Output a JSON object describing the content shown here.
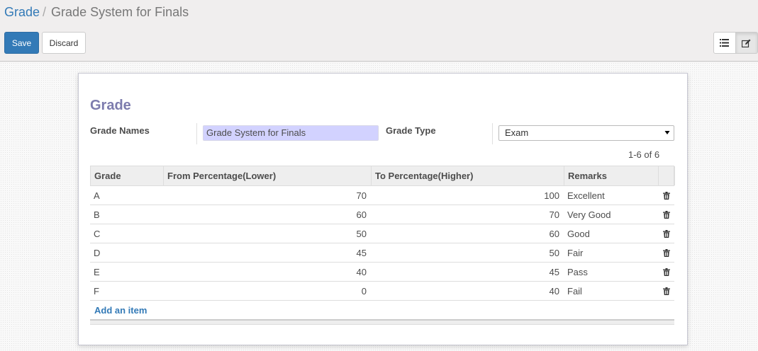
{
  "breadcrumb": {
    "parent": "Grade",
    "separator": "/",
    "current": "Grade System for Finals"
  },
  "toolbar": {
    "save_label": "Save",
    "discard_label": "Discard"
  },
  "view_switcher": {
    "list_icon": "list-icon",
    "form_icon": "edit-icon",
    "active": "form"
  },
  "form": {
    "title": "Grade",
    "grade_names_label": "Grade Names",
    "grade_names_value": "Grade System for Finals",
    "grade_type_label": "Grade Type",
    "grade_type_value": "Exam"
  },
  "pager": "1-6 of 6",
  "grid": {
    "headers": [
      "Grade",
      "From Percentage(Lower)",
      "To Percentage(Higher)",
      "Remarks"
    ],
    "rows": [
      {
        "grade": "A",
        "from": "70",
        "to": "100",
        "remarks": "Excellent"
      },
      {
        "grade": "B",
        "from": "60",
        "to": "70",
        "remarks": "Very Good"
      },
      {
        "grade": "C",
        "from": "50",
        "to": "60",
        "remarks": "Good"
      },
      {
        "grade": "D",
        "from": "45",
        "to": "50",
        "remarks": "Fair"
      },
      {
        "grade": "E",
        "from": "40",
        "to": "45",
        "remarks": "Pass"
      },
      {
        "grade": "F",
        "from": "0",
        "to": "40",
        "remarks": "Fail"
      }
    ],
    "add_item_label": "Add an item",
    "delete_icon": "trash-icon"
  },
  "colors": {
    "primary": "#337ab7",
    "title": "#7c7bad",
    "required_field": "#d2d2ff"
  }
}
